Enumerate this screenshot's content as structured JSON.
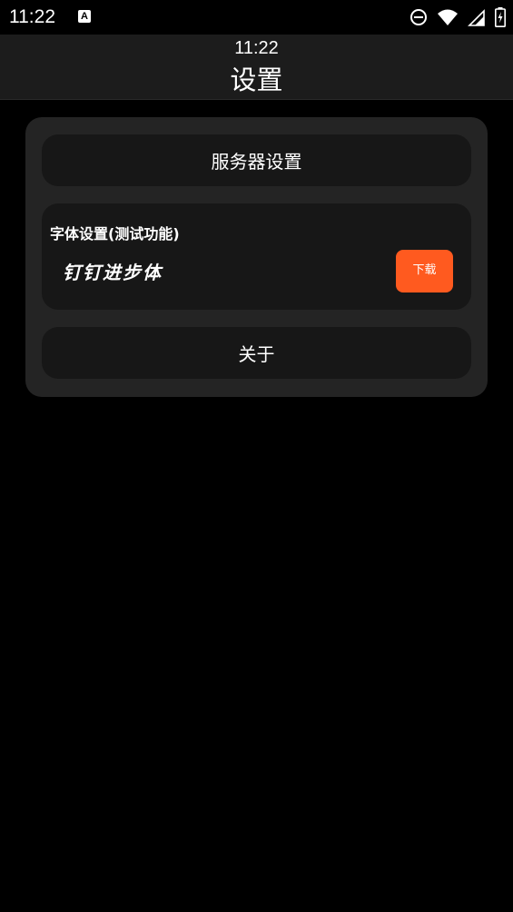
{
  "status_bar": {
    "time": "11:22",
    "app_icon_letter": "A",
    "icons": [
      "do-not-disturb-icon",
      "wifi-icon",
      "cellular-signal-icon",
      "battery-charging-icon"
    ]
  },
  "header": {
    "time": "11:22",
    "title": "设置"
  },
  "settings": {
    "server_label": "服务器设置",
    "font_section": {
      "title": "字体设置(测试功能)",
      "font_name": "钉钉进步体",
      "download_label": "下载"
    },
    "about_label": "关于"
  },
  "colors": {
    "background": "#000000",
    "header_bg": "#1c1c1c",
    "card_bg": "#242424",
    "row_bg": "#171717",
    "accent": "#ff5a1f"
  }
}
